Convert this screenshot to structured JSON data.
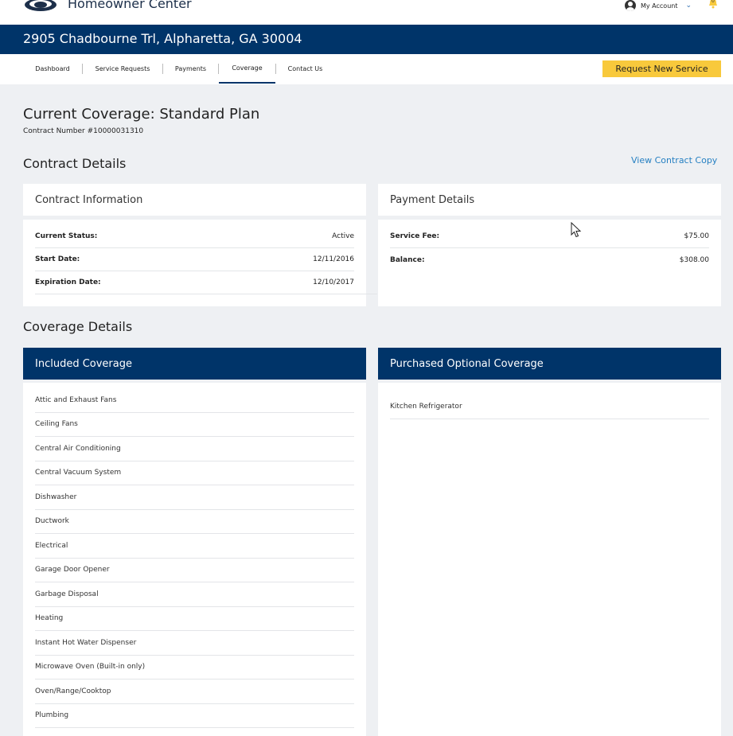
{
  "header": {
    "brand": "Homeowner Center",
    "account_label": "My Account",
    "notifications_count": "0"
  },
  "address": "2905 Chadbourne Trl, Alpharetta, GA 30004",
  "nav": {
    "tabs": [
      {
        "label": "Dashboard"
      },
      {
        "label": "Service Requests"
      },
      {
        "label": "Payments"
      },
      {
        "label": "Coverage"
      },
      {
        "label": "Contact Us"
      }
    ],
    "active_tab": "Coverage",
    "request_button": "Request New Service"
  },
  "page": {
    "title": "Current Coverage: Standard Plan",
    "contract_number": "Contract Number #10000031310"
  },
  "contract_details": {
    "heading": "Contract Details",
    "view_copy_link": "View Contract Copy",
    "contract_info": {
      "title": "Contract Information",
      "rows": [
        {
          "label": "Current Status:",
          "value": "Active"
        },
        {
          "label": "Start Date:",
          "value": "12/11/2016"
        },
        {
          "label": "Expiration Date:",
          "value": "12/10/2017"
        }
      ]
    },
    "payment_details": {
      "title": "Payment Details",
      "rows": [
        {
          "label": "Service Fee:",
          "value": "$75.00"
        },
        {
          "label": "Balance:",
          "value": "$308.00"
        }
      ]
    }
  },
  "coverage_details": {
    "heading": "Coverage Details",
    "included": {
      "title": "Included Coverage",
      "items": [
        "Attic and Exhaust Fans",
        "Ceiling Fans",
        "Central Air Conditioning",
        "Central Vacuum System",
        "Dishwasher",
        "Ductwork",
        "Electrical",
        "Garage Door Opener",
        "Garbage Disposal",
        "Heating",
        "Instant Hot Water Dispenser",
        "Microwave Oven (Built-in only)",
        "Oven/Range/Cooktop",
        "Plumbing"
      ]
    },
    "optional": {
      "title": "Purchased Optional Coverage",
      "items": [
        "Kitchen Refrigerator"
      ]
    }
  },
  "colors": {
    "brand_navy": "#003469",
    "accent_yellow": "#f8c93c",
    "link_blue": "#2680c2",
    "page_bg": "#eef0f3"
  }
}
